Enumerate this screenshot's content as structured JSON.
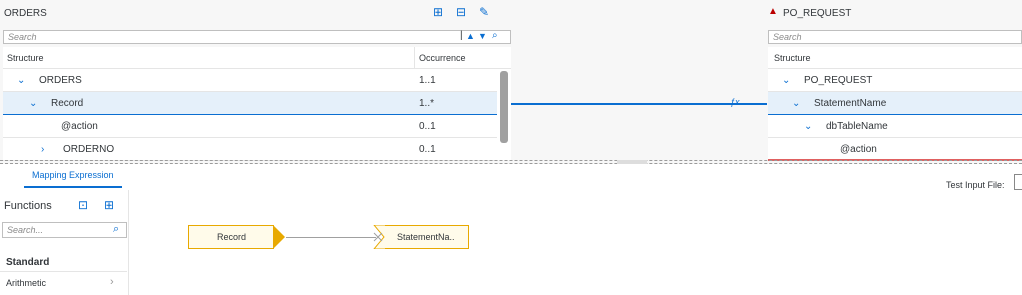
{
  "source": {
    "title": "ORDERS",
    "search_placeholder": "Search",
    "col_structure": "Structure",
    "col_occurrence": "Occurrence",
    "rows": [
      {
        "name": "ORDERS",
        "occ": "1..1"
      },
      {
        "name": "Record",
        "occ": "1..*"
      },
      {
        "name": "@action",
        "occ": "0..1"
      },
      {
        "name": "ORDERNO",
        "occ": "0..1"
      }
    ]
  },
  "target": {
    "title": "PO_REQUEST",
    "search_placeholder": "Search",
    "col_structure": "Structure",
    "rows": [
      {
        "name": "PO_REQUEST"
      },
      {
        "name": "StatementName"
      },
      {
        "name": "dbTableName"
      },
      {
        "name": "@action"
      }
    ]
  },
  "bottom": {
    "tab_label": "Mapping Expression",
    "test_input_label": "Test Input File:",
    "functions_title": "Functions",
    "functions_search_placeholder": "Search...",
    "category_header": "Standard",
    "category_items": [
      "Arithmetic"
    ]
  },
  "canvas": {
    "source_node": "Record",
    "target_node": "StatementNa.."
  },
  "colors": {
    "accent": "#0a6ed1",
    "warning": "#bb0000",
    "node_border": "#e8a900"
  }
}
